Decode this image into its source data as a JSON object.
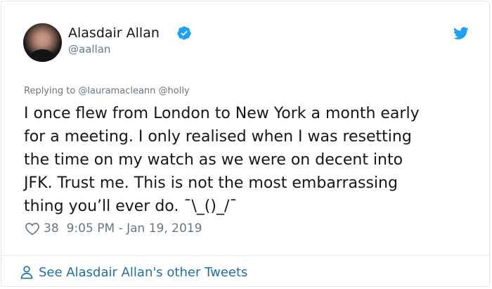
{
  "author": {
    "display_name": "Alasdair Allan",
    "handle": "@aallan",
    "verified": true
  },
  "reply": {
    "text": "Replying to @lauramacleann @holly"
  },
  "tweet": {
    "lines": [
      "I once flew from London to New York a month early",
      "for a meeting. I only realised when I was resetting",
      "the time on my watch as we were on decent into",
      "JFK. Trust me. This is not the most embarrassing",
      "thing you’ll ever do. ¯\\_()_/¯"
    ]
  },
  "meta": {
    "likes": "38",
    "timestamp": "9:05 PM - Jan 19, 2019"
  },
  "footer": {
    "link_text": "See Alasdair Allan's other Tweets"
  },
  "colors": {
    "brand_blue": "#1da1f2",
    "link_blue": "#1b6fa8",
    "text": "#14171a",
    "muted": "#657786"
  },
  "icons": [
    "avatar",
    "verified-badge-icon",
    "twitter-bird-icon",
    "heart-icon",
    "person-icon"
  ]
}
